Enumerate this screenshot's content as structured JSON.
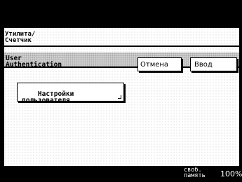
{
  "header": {
    "title": "Утилита/\nСчетчик"
  },
  "auth": {
    "title": "User\nAuthentication"
  },
  "buttons": {
    "cancel": "Отмена",
    "enter": "Ввод"
  },
  "menu": {
    "user_settings": "Настройки\nпользователя"
  },
  "status": {
    "memory_label": "своб.\nпамять",
    "memory_value": "100%"
  }
}
